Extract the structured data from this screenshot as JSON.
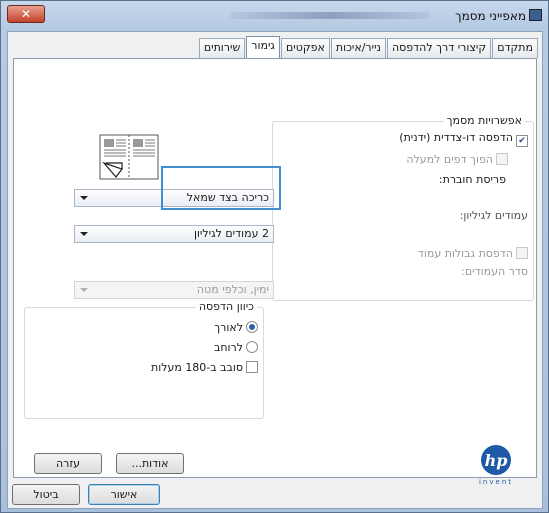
{
  "window": {
    "title": "מאפייני מסמך",
    "close_glyph": "✕"
  },
  "tabs": [
    {
      "label": "מתקדם",
      "active": false
    },
    {
      "label": "קיצורי דרך להדפסה",
      "active": false
    },
    {
      "label": "נייר/איכות",
      "active": false
    },
    {
      "label": "אפקטים",
      "active": false
    },
    {
      "label": "גימור",
      "active": true
    },
    {
      "label": "שירותים",
      "active": false
    }
  ],
  "document_options": {
    "title": "אפשרויות מסמך",
    "duplex_label": "הדפסה דו-צדדית (ידנית)",
    "duplex_checked": true,
    "flip_pages_label": "הפוך דפים למעלה",
    "flip_pages_checked": false,
    "booklet_layout_label": "פריסת חוברת:",
    "booklet_layout_value": "כריכה בצד שמאל",
    "pages_per_sheet_label": "עמודים לגיליון:",
    "pages_per_sheet_value": "2 עמודים לגיליון",
    "print_borders_label": "הדפסת גבולות עמוד",
    "print_borders_checked": false,
    "page_order_label": "סדר העמודים:",
    "page_order_value": "ימין, וכלפי מטה"
  },
  "orientation": {
    "title": "כיוון הדפסה",
    "portrait_label": "לאורך",
    "portrait_selected": true,
    "landscape_label": "לרוחב",
    "landscape_selected": false,
    "rotate_label": "סובב ב-180 מעלות",
    "rotate_checked": false
  },
  "buttons": {
    "about": "אודות...",
    "help": "עזרה",
    "ok": "אישור",
    "cancel": "ביטול"
  },
  "logo": {
    "brand": "hp",
    "tagline": "invent"
  },
  "colors": {
    "accent": "#3f8fd2",
    "hp_blue": "#1f5aa6"
  }
}
